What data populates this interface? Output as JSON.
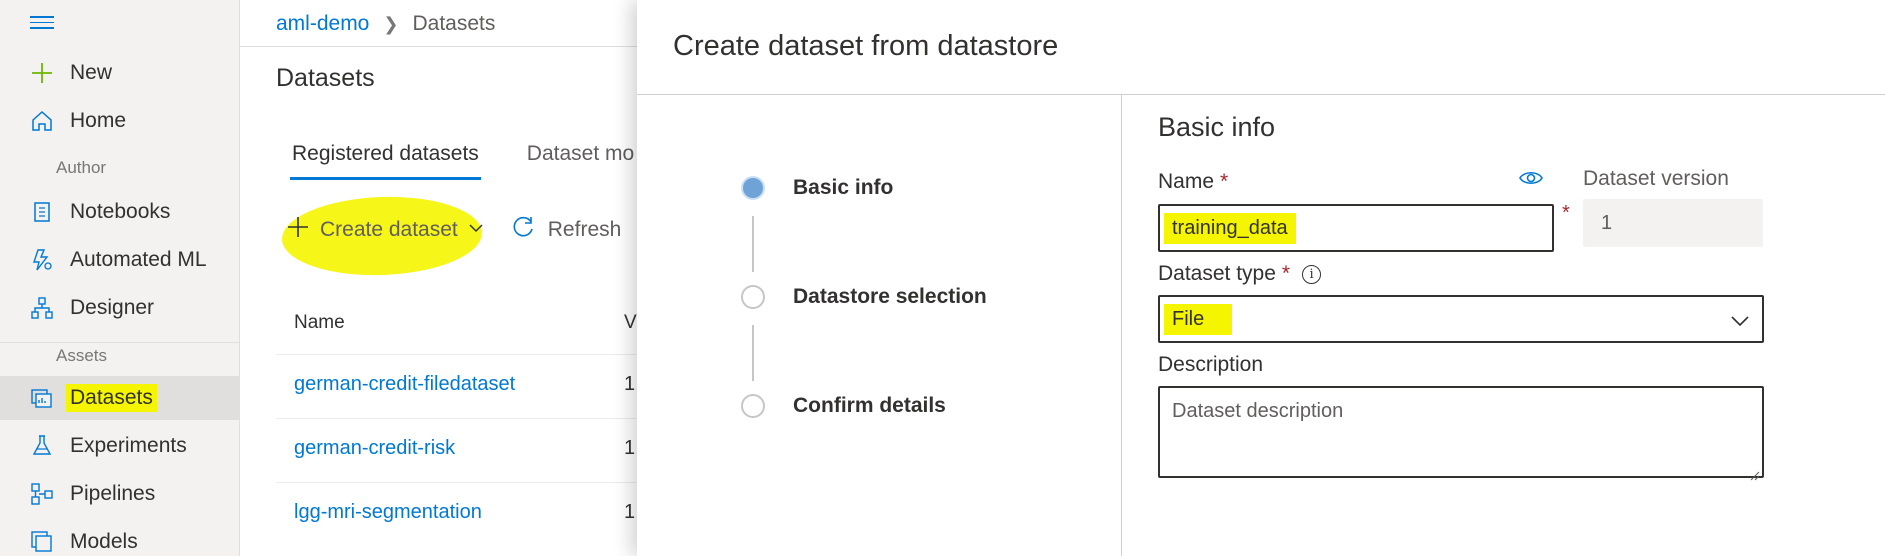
{
  "nav": {
    "items_top": [
      {
        "label": "New",
        "icon": "plus-icon"
      },
      {
        "label": "Home",
        "icon": "home-icon"
      }
    ],
    "section_author": "Author",
    "items_author": [
      {
        "label": "Notebooks",
        "icon": "notebook-icon"
      },
      {
        "label": "Automated ML",
        "icon": "automl-icon"
      },
      {
        "label": "Designer",
        "icon": "designer-icon"
      }
    ],
    "section_assets": "Assets",
    "items_assets": [
      {
        "label": "Datasets",
        "icon": "datasets-icon",
        "active": true
      },
      {
        "label": "Experiments",
        "icon": "flask-icon"
      },
      {
        "label": "Pipelines",
        "icon": "pipelines-icon"
      },
      {
        "label": "Models",
        "icon": "models-icon"
      }
    ]
  },
  "breadcrumb": {
    "workspace": "aml-demo",
    "current": "Datasets"
  },
  "page": {
    "title": "Datasets",
    "tabs": [
      "Registered datasets",
      "Dataset mo"
    ],
    "toolbar": {
      "create": "Create dataset",
      "refresh": "Refresh"
    },
    "table": {
      "col_name": "Name",
      "col_version": "V",
      "rows": [
        {
          "name": "german-credit-filedataset",
          "version": "1"
        },
        {
          "name": "german-credit-risk",
          "version": "1"
        },
        {
          "name": "lgg-mri-segmentation",
          "version": "1"
        }
      ]
    }
  },
  "panel": {
    "title": "Create dataset from datastore",
    "steps": [
      "Basic info",
      "Datastore selection",
      "Confirm details"
    ],
    "form": {
      "heading": "Basic info",
      "name_label": "Name",
      "name_value": "training_data",
      "version_label": "Dataset version",
      "version_value": "1",
      "type_label": "Dataset type",
      "type_value": "File",
      "description_label": "Description",
      "description_placeholder": "Dataset description",
      "required_mark": "*"
    }
  },
  "colors": {
    "accent": "#0078d4",
    "highlight": "#f5f500",
    "required": "#a4262c"
  }
}
